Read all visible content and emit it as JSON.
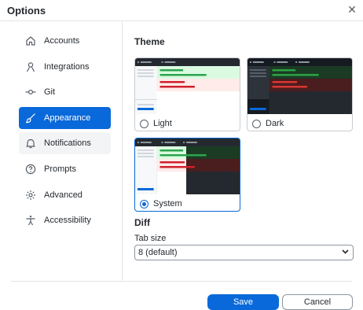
{
  "dialog": {
    "title": "Options",
    "close_icon": "close-icon"
  },
  "sidebar": {
    "items": [
      {
        "label": "Accounts",
        "icon": "home-icon"
      },
      {
        "label": "Integrations",
        "icon": "person-icon"
      },
      {
        "label": "Git",
        "icon": "git-commit-icon"
      },
      {
        "label": "Appearance",
        "icon": "paintbrush-icon",
        "active": true
      },
      {
        "label": "Notifications",
        "icon": "bell-icon"
      },
      {
        "label": "Prompts",
        "icon": "question-icon"
      },
      {
        "label": "Advanced",
        "icon": "gear-icon"
      },
      {
        "label": "Accessibility",
        "icon": "accessibility-icon"
      }
    ]
  },
  "theme": {
    "heading": "Theme",
    "options": [
      {
        "label": "Light",
        "selected": false
      },
      {
        "label": "Dark",
        "selected": false
      },
      {
        "label": "System",
        "selected": true
      }
    ]
  },
  "diff": {
    "heading": "Diff",
    "tab_size_label": "Tab size",
    "tab_size_value": "8 (default)"
  },
  "footer": {
    "save_label": "Save",
    "cancel_label": "Cancel"
  },
  "colors": {
    "accent": "#0969da",
    "added_light": "#2da44e",
    "removed_light": "#cf222e",
    "dark_bg": "#24292f"
  }
}
